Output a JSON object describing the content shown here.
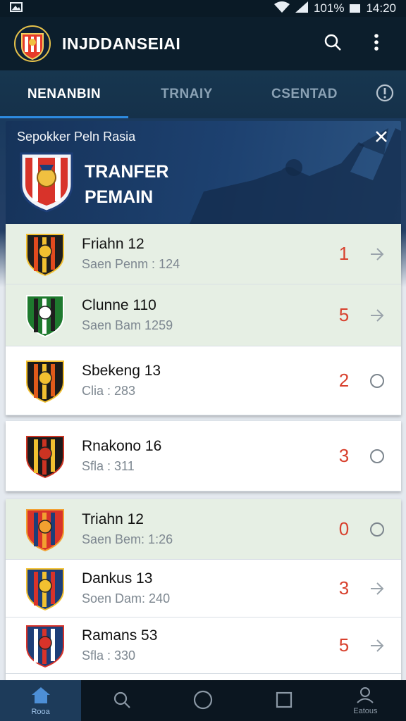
{
  "status_bar": {
    "battery": "101%",
    "time": "14:20"
  },
  "app_bar": {
    "title": "INJDDANSEIAI",
    "logo_icon": "club-crest-icon",
    "search_icon": "search-icon",
    "menu_icon": "more-vert-icon"
  },
  "tabs": [
    {
      "label": "NENANBIN",
      "active": true
    },
    {
      "label": "TRNAIY",
      "active": false
    },
    {
      "label": "CSENTAD",
      "active": false
    }
  ],
  "tab_info_icon": "info-icon",
  "header": {
    "subtitle": "Sepokker Peln Rasia",
    "title": "TRANFER PEMAIN",
    "close_icon": "close-icon"
  },
  "list": [
    {
      "name": "Friahn 12",
      "sub": "Saen Penm : 124",
      "count": "1",
      "action": "arrow-right-icon",
      "highlight": true
    },
    {
      "name": "Clunne 110",
      "sub": "Saen Bam 1259",
      "count": "5",
      "action": "arrow-right-icon",
      "highlight": true
    },
    {
      "name": "Sbekeng 13",
      "sub": "Clia : 283",
      "count": "2",
      "action": "radio-icon",
      "highlight": false
    },
    {
      "name": "Rnakono 16",
      "sub": "Sfla : 311",
      "count": "3",
      "action": "radio-icon",
      "highlight": false
    },
    {
      "name": "Triahn 12",
      "sub": "Saen Bem: 1:26",
      "count": "0",
      "action": "radio-icon",
      "highlight": true
    },
    {
      "name": "Dankus 13",
      "sub": "Soen Dam: 240",
      "count": "3",
      "action": "arrow-right-icon",
      "highlight": false
    },
    {
      "name": "Ramans 53",
      "sub": "Sfla : 330",
      "count": "5",
      "action": "arrow-right-icon",
      "highlight": false
    }
  ],
  "bottom_nav": [
    {
      "label": "Rooa",
      "icon": "home-icon",
      "active": true
    },
    {
      "label": "",
      "icon": "search-icon",
      "active": false
    },
    {
      "label": "",
      "icon": "circle-icon",
      "active": false
    },
    {
      "label": "",
      "icon": "square-icon",
      "active": false
    },
    {
      "label": "Eatous",
      "icon": "profile-icon",
      "active": false
    }
  ],
  "colors": {
    "accent": "#2d8be0",
    "count_red": "#d8412e",
    "highlight_row": "#e6efe4",
    "app_bar": "#0c1e2c"
  }
}
